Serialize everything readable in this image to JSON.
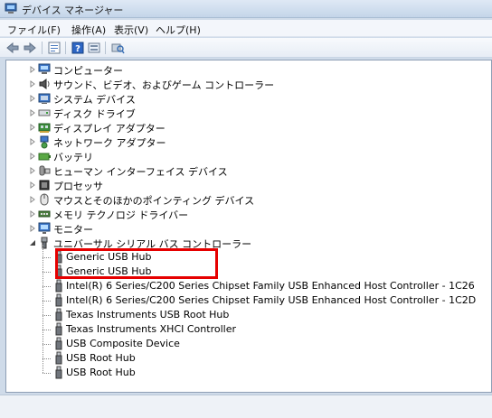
{
  "window": {
    "title": "デバイス マネージャー"
  },
  "menubar": {
    "items": [
      "ファイル(F)",
      "操作(A)",
      "表示(V)",
      "ヘルプ(H)"
    ]
  },
  "toolbar": {
    "icons": [
      "back-arrow-icon",
      "forward-arrow-icon",
      "properties-icon",
      "help-icon",
      "view-icon",
      "scan-hardware-icon"
    ]
  },
  "tree": {
    "categories": [
      {
        "label": "コンピューター",
        "icon": "computer-icon"
      },
      {
        "label": "サウンド、ビデオ、およびゲーム コントローラー",
        "icon": "speaker-icon"
      },
      {
        "label": "システム デバイス",
        "icon": "system-device-icon"
      },
      {
        "label": "ディスク ドライブ",
        "icon": "disk-drive-icon"
      },
      {
        "label": "ディスプレイ アダプター",
        "icon": "display-adapter-icon"
      },
      {
        "label": "ネットワーク アダプター",
        "icon": "network-icon"
      },
      {
        "label": "バッテリ",
        "icon": "battery-icon"
      },
      {
        "label": "ヒューマン インターフェイス デバイス",
        "icon": "hid-icon"
      },
      {
        "label": "プロセッサ",
        "icon": "processor-icon"
      },
      {
        "label": "マウスとそのほかのポインティング デバイス",
        "icon": "mouse-icon"
      },
      {
        "label": "メモリ テクノロジ ドライバー",
        "icon": "memory-icon"
      },
      {
        "label": "モニター",
        "icon": "monitor-icon"
      },
      {
        "label": "ユニバーサル シリアル バス コントローラー",
        "icon": "usb-icon"
      }
    ],
    "usb_children": [
      "Generic USB Hub",
      "Generic USB Hub",
      "Intel(R) 6 Series/C200 Series Chipset Family USB Enhanced Host Controller - 1C26",
      "Intel(R) 6 Series/C200 Series Chipset Family USB Enhanced Host Controller - 1C2D",
      "Texas Instruments USB Root Hub",
      "Texas Instruments XHCI Controller",
      "USB Composite Device",
      "USB Root Hub",
      "USB Root Hub"
    ]
  },
  "colors": {
    "highlight": "#e60000",
    "pane_bg": "#ffffff",
    "frame_bg": "#cfdbe9"
  }
}
